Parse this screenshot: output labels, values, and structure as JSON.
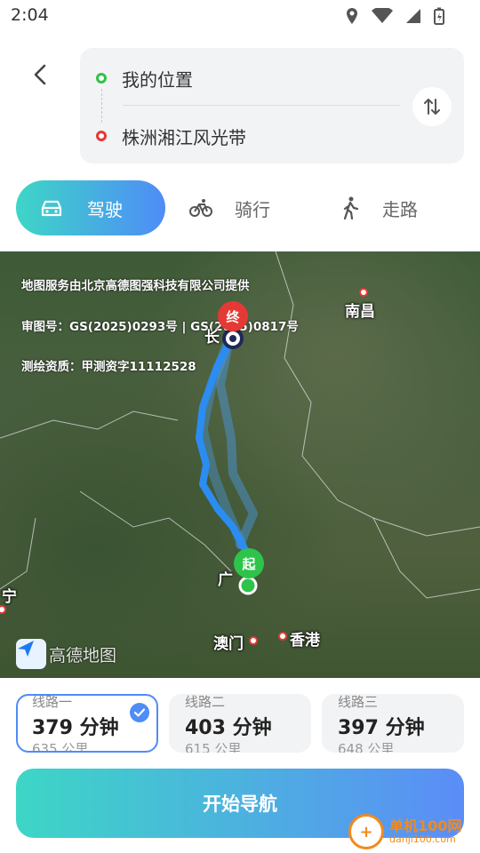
{
  "status_bar": {
    "time": "2:04"
  },
  "route": {
    "from": "我的位置",
    "to": "株洲湘江风光带"
  },
  "modes": [
    {
      "label": "驾驶",
      "active": true
    },
    {
      "label": "骑行",
      "active": false
    },
    {
      "label": "走路",
      "active": false
    }
  ],
  "map": {
    "notices": [
      "地图服务由北京高德图强科技有限公司提供",
      "审图号：GS(2025)0293号 | GS(2025)0817号",
      "测绘资质：甲测资字11112528"
    ],
    "cities": {
      "nanchang": "南昌",
      "chang": "长",
      "guang": "广",
      "ning": "宁",
      "macau": "澳门",
      "hongkong": "香港"
    },
    "end_pin": "终",
    "start_pin": "起",
    "logo_text": "高德地图",
    "route_color": "#2b8cf2"
  },
  "options": [
    {
      "name": "线路一",
      "time": "379 分钟",
      "distance": "635 公里",
      "selected": true
    },
    {
      "name": "线路二",
      "time": "403 分钟",
      "distance": "615 公里",
      "selected": false
    },
    {
      "name": "线路三",
      "time": "397 分钟",
      "distance": "648 公里",
      "selected": false
    }
  ],
  "start_button": "开始导航",
  "watermark": {
    "title": "单机100网",
    "url": "danji100.com"
  }
}
